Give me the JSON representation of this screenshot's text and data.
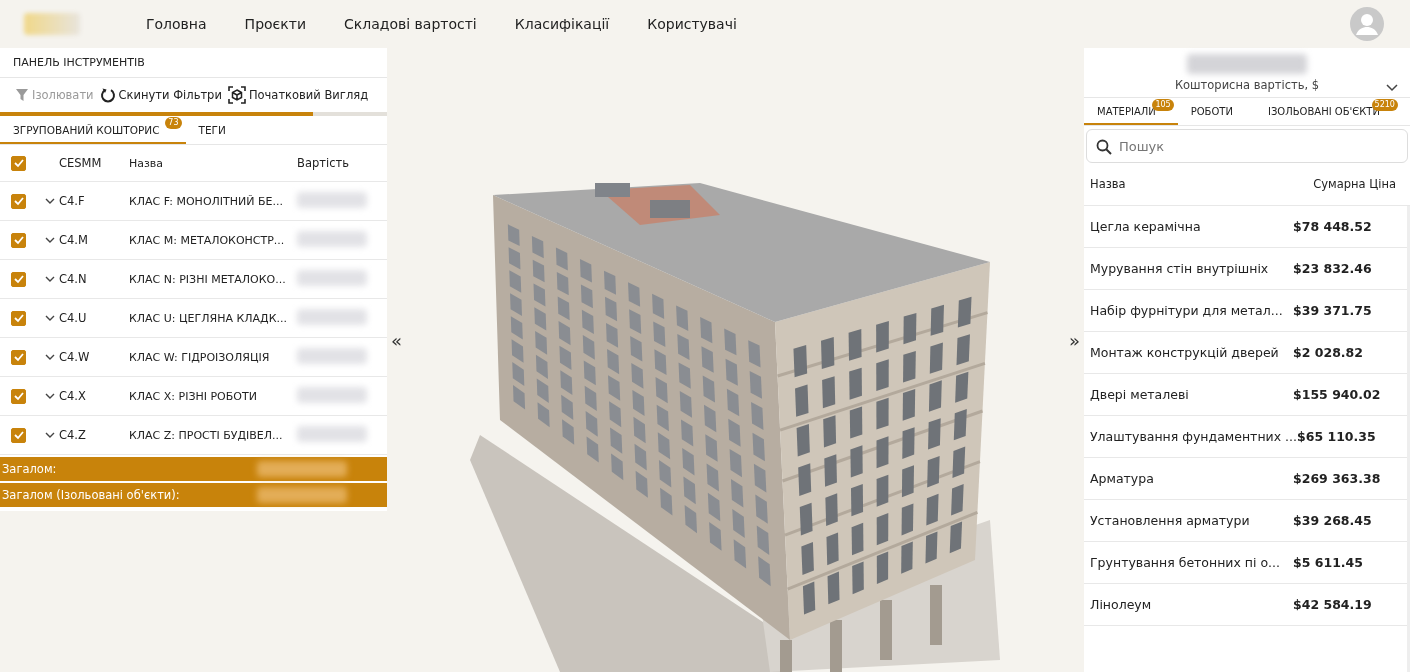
{
  "nav": {
    "items": [
      "Головна",
      "Проєкти",
      "Складові вартості",
      "Класифікації",
      "Користувачі"
    ]
  },
  "left_panel": {
    "title": "ПАНЕЛЬ ІНСТРУМЕНТІВ",
    "toolbar": [
      {
        "kind": "filter",
        "label": "Ізолювати",
        "disabled": true
      },
      {
        "kind": "reset",
        "label": "Скинути Фільтри",
        "disabled": false
      },
      {
        "kind": "view",
        "label": "Початковий Вигляд",
        "disabled": false
      }
    ],
    "progress": {
      "level": 0.81
    },
    "tabs": [
      {
        "label": "ЗГРУПОВАНИЙ КОШТОРИС",
        "badge": "73",
        "selected": true
      },
      {
        "label": "ТЕГИ",
        "selected": false
      }
    ],
    "table": {
      "all_checked": true,
      "columns": [
        "CESMM",
        "Назва",
        "Вартість"
      ],
      "rows": [
        {
          "checked": true,
          "code": "C4.F",
          "name": "КЛАС F: МОНОЛІТНИЙ БЕ..."
        },
        {
          "checked": true,
          "code": "C4.M",
          "name": "КЛАС M: МЕТАЛОКОНСТР..."
        },
        {
          "checked": true,
          "code": "C4.N",
          "name": "КЛАС N: РІЗНІ МЕТАЛОКО..."
        },
        {
          "checked": true,
          "code": "C4.U",
          "name": "КЛАС U: ЦЕГЛЯНА КЛАДК..."
        },
        {
          "checked": true,
          "code": "C4.W",
          "name": "КЛАС W: ГІДРОІЗОЛЯЦІЯ"
        },
        {
          "checked": true,
          "code": "C4.X",
          "name": "КЛАС X: РІЗНІ РОБОТИ"
        },
        {
          "checked": true,
          "code": "C4.Z",
          "name": "КЛАС Z: ПРОСТІ БУДІВЕЛ..."
        }
      ]
    },
    "totals": [
      "Загалом:",
      "Загалом (Ізольовані об'єкти):"
    ]
  },
  "viewer": {
    "collapse_left": "«",
    "collapse_right": "»"
  },
  "right_panel": {
    "caption": "Кошторисна вартість, $",
    "tabs": [
      {
        "label": "МАТЕРІАЛИ",
        "badge": "105",
        "selected": true
      },
      {
        "label": "РОБОТИ",
        "selected": false
      },
      {
        "label": "ІЗОЛЬОВАНІ ОБ'ЄКТИ",
        "badge": "5210",
        "selected": false
      }
    ],
    "search": {
      "placeholder": "Пошук"
    },
    "columns": [
      "Назва",
      "Сумарна Ціна"
    ],
    "rows": [
      {
        "name": "Цегла керамічна",
        "price": "$78 448.52"
      },
      {
        "name": "Мурування стін внутрішніх",
        "price": "$23 832.46"
      },
      {
        "name": "Набір фурнітури для метал...",
        "price": "$39 371.75"
      },
      {
        "name": "Монтаж конструкцій дверей",
        "price": "$2 028.82"
      },
      {
        "name": "Двері металеві",
        "price": "$155 940.02"
      },
      {
        "name": "Улаштування фундаментних ...",
        "price": "$65 110.35"
      },
      {
        "name": "Арматура",
        "price": "$269 363.38"
      },
      {
        "name": "Установлення арматури",
        "price": "$39 268.45"
      },
      {
        "name": "Грунтування бетонних пі о...",
        "price": "$5 611.45"
      },
      {
        "name": "Лінолеум",
        "price": "$42 584.19"
      }
    ]
  }
}
